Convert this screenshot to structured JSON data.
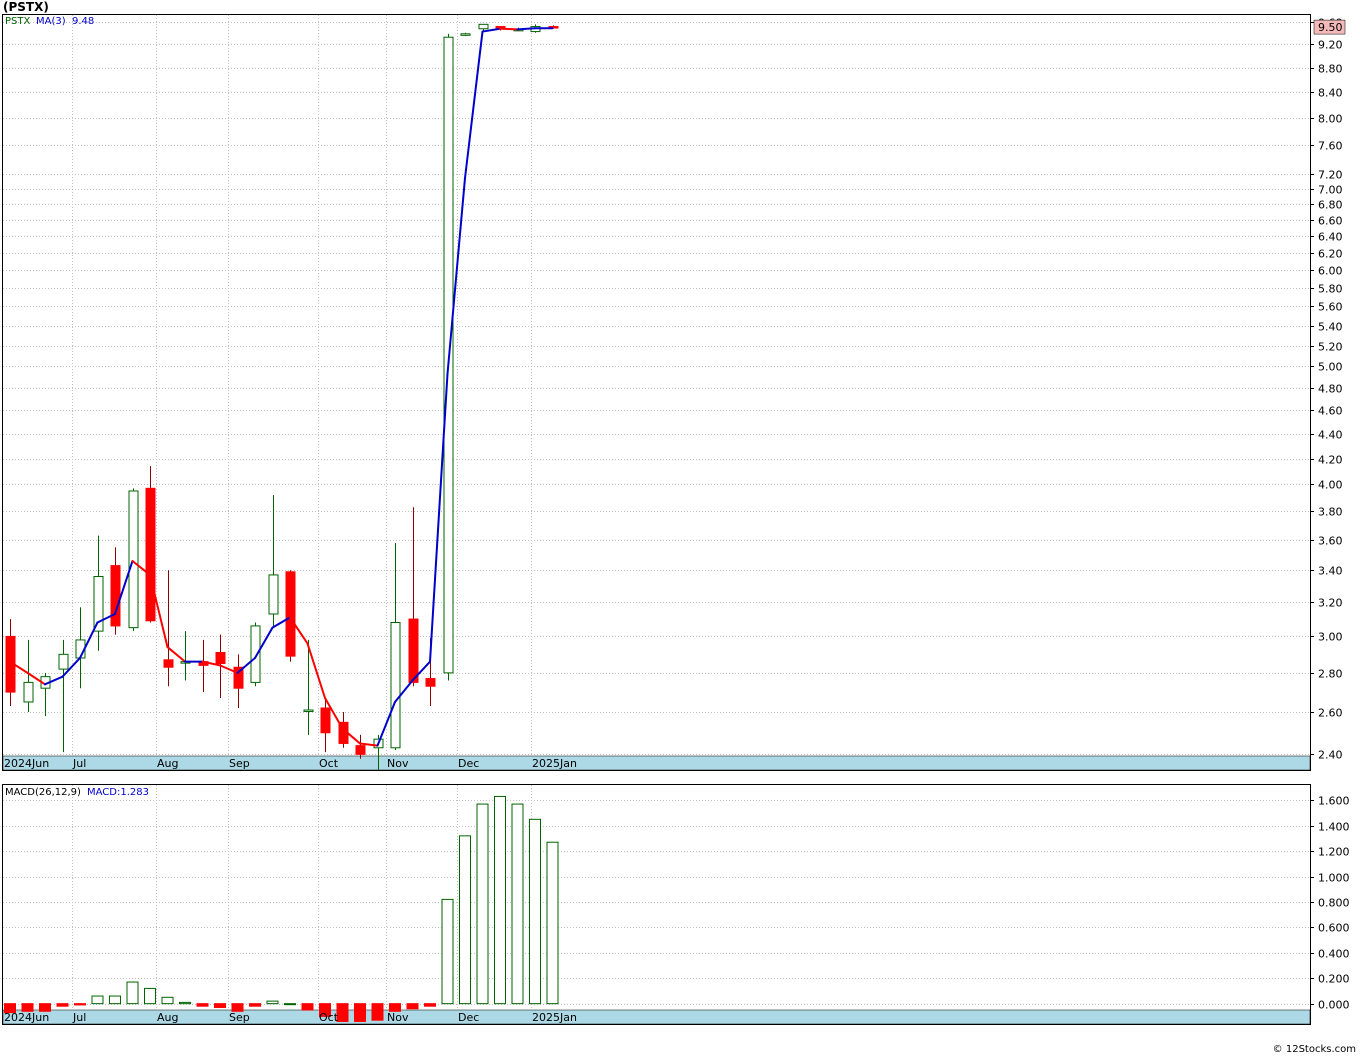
{
  "title": "(PSTX)",
  "footer": "© 12Stocks.com",
  "colors": {
    "up": "#006400",
    "down": "#ff0000",
    "ma_up": "#0000cc",
    "ma_down": "#ff0000",
    "axis_strip": "#add8e6",
    "grid": "#c0c0c0",
    "last_price_bg": "#f4b9b9"
  },
  "chart_data": [
    {
      "type": "candlestick",
      "symbol": "PSTX",
      "legend": {
        "symbol": "PSTX",
        "ma_label": "MA(3)",
        "ma_value": "9.48"
      },
      "last_price": "9.50",
      "y_scale": "log",
      "ylim": [
        2.33,
        9.72
      ],
      "y_ticks": [
        "9.60",
        "9.20",
        "8.80",
        "8.40",
        "8.00",
        "7.60",
        "7.20",
        "7.00",
        "6.80",
        "6.60",
        "6.40",
        "6.20",
        "6.00",
        "5.80",
        "5.60",
        "5.40",
        "5.20",
        "5.00",
        "4.80",
        "4.60",
        "4.40",
        "4.20",
        "4.00",
        "3.80",
        "3.60",
        "3.40",
        "3.20",
        "3.00",
        "2.80",
        "2.60",
        "2.40"
      ],
      "x_labels": [
        "2024Jun",
        "Jul",
        "Aug",
        "Sep",
        "Oct",
        "Nov",
        "Dec",
        "2025Jan"
      ],
      "candles": [
        {
          "o": 3.0,
          "h": 3.1,
          "l": 2.63,
          "c": 2.7
        },
        {
          "o": 2.65,
          "h": 2.98,
          "l": 2.6,
          "c": 2.75
        },
        {
          "o": 2.72,
          "h": 2.8,
          "l": 2.58,
          "c": 2.78
        },
        {
          "o": 2.82,
          "h": 2.98,
          "l": 2.41,
          "c": 2.9
        },
        {
          "o": 2.88,
          "h": 3.17,
          "l": 2.72,
          "c": 2.98
        },
        {
          "o": 3.03,
          "h": 3.63,
          "l": 2.92,
          "c": 3.36
        },
        {
          "o": 3.43,
          "h": 3.55,
          "l": 3.01,
          "c": 3.06
        },
        {
          "o": 3.05,
          "h": 3.97,
          "l": 3.03,
          "c": 3.95
        },
        {
          "o": 3.97,
          "h": 4.14,
          "l": 3.08,
          "c": 3.09
        },
        {
          "o": 2.87,
          "h": 3.4,
          "l": 2.73,
          "c": 2.83
        },
        {
          "o": 2.86,
          "h": 3.03,
          "l": 2.76,
          "c": 2.86
        },
        {
          "o": 2.86,
          "h": 2.98,
          "l": 2.7,
          "c": 2.84
        },
        {
          "o": 2.91,
          "h": 3.01,
          "l": 2.67,
          "c": 2.85
        },
        {
          "o": 2.83,
          "h": 2.9,
          "l": 2.62,
          "c": 2.72
        },
        {
          "o": 2.75,
          "h": 3.08,
          "l": 2.73,
          "c": 3.06
        },
        {
          "o": 3.13,
          "h": 3.92,
          "l": 3.05,
          "c": 3.37
        },
        {
          "o": 3.39,
          "h": 3.4,
          "l": 2.86,
          "c": 2.89
        },
        {
          "o": 2.61,
          "h": 2.98,
          "l": 2.49,
          "c": 2.61
        },
        {
          "o": 2.62,
          "h": 2.66,
          "l": 2.41,
          "c": 2.5
        },
        {
          "o": 2.55,
          "h": 2.6,
          "l": 2.43,
          "c": 2.45
        },
        {
          "o": 2.44,
          "h": 2.49,
          "l": 2.38,
          "c": 2.4
        },
        {
          "o": 2.43,
          "h": 2.49,
          "l": 2.33,
          "c": 2.47
        },
        {
          "o": 2.43,
          "h": 3.58,
          "l": 2.42,
          "c": 3.08
        },
        {
          "o": 3.1,
          "h": 3.83,
          "l": 2.73,
          "c": 2.75
        },
        {
          "o": 2.77,
          "h": 2.99,
          "l": 2.63,
          "c": 2.73
        },
        {
          "o": 2.8,
          "h": 9.38,
          "l": 2.76,
          "c": 9.32
        },
        {
          "o": 9.36,
          "h": 9.4,
          "l": 9.34,
          "c": 9.38
        },
        {
          "o": 9.47,
          "h": 9.55,
          "l": 9.42,
          "c": 9.55
        },
        {
          "o": 9.51,
          "h": 9.52,
          "l": 9.44,
          "c": 9.48
        },
        {
          "o": 9.45,
          "h": 9.49,
          "l": 9.43,
          "c": 9.46
        },
        {
          "o": 9.42,
          "h": 9.55,
          "l": 9.4,
          "c": 9.51
        },
        {
          "o": 9.51,
          "h": 9.53,
          "l": 9.48,
          "c": 9.5
        }
      ],
      "ma3": [
        2.86,
        2.8,
        2.74,
        2.78,
        2.88,
        3.08,
        3.13,
        3.46,
        3.37,
        2.94,
        2.86,
        2.86,
        2.84,
        2.8,
        2.88,
        3.05,
        3.11,
        2.96,
        2.67,
        2.52,
        2.45,
        2.44,
        2.65,
        2.76,
        2.86,
        4.93,
        7.14,
        9.42,
        9.47,
        9.46,
        9.48,
        9.48
      ]
    },
    {
      "type": "bar",
      "name": "MACD",
      "legend": {
        "params": "MACD(26,12,9)",
        "value_label": "MACD:1.283"
      },
      "ylim": [
        -0.16,
        1.72
      ],
      "y_ticks": [
        "1.600",
        "1.400",
        "1.200",
        "1.000",
        "0.800",
        "0.600",
        "0.400",
        "0.200",
        "0.000"
      ],
      "x_labels": [
        "2024Jun",
        "Jul",
        "Aug",
        "Sep",
        "Oct",
        "Nov",
        "Dec",
        "2025Jan"
      ],
      "values": [
        -0.07,
        -0.06,
        -0.06,
        -0.02,
        -0.01,
        0.06,
        0.06,
        0.17,
        0.12,
        0.05,
        0.01,
        -0.02,
        -0.03,
        -0.06,
        -0.02,
        0.02,
        0.0,
        -0.05,
        -0.1,
        -0.14,
        -0.14,
        -0.13,
        -0.06,
        -0.04,
        -0.02,
        0.82,
        1.32,
        1.57,
        1.63,
        1.57,
        1.45,
        1.27
      ]
    }
  ]
}
